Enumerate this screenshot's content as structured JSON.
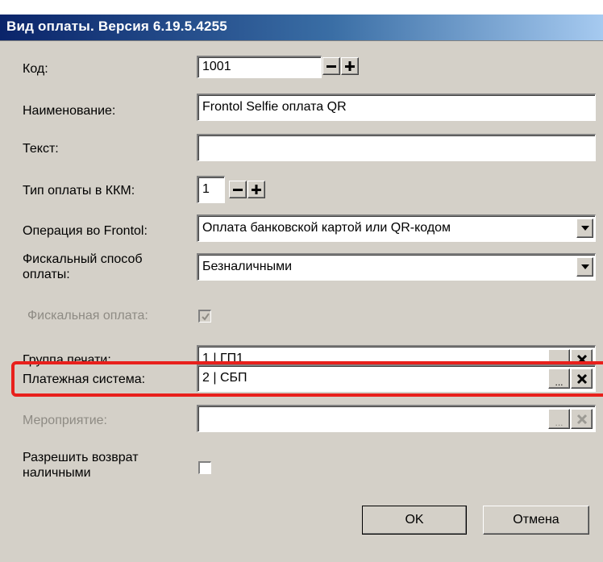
{
  "window": {
    "title": "Вид оплаты. Версия 6.19.5.4255"
  },
  "fields": {
    "code": {
      "label": "Код:",
      "value": "1001"
    },
    "name": {
      "label": "Наименование:",
      "value": "Frontol Selfie оплата QR"
    },
    "text": {
      "label": "Текст:",
      "value": ""
    },
    "kkm_type": {
      "label": "Тип оплаты в ККМ:",
      "value": "1"
    },
    "frontol_operation": {
      "label": "Операция во Frontol:",
      "value": "Оплата банковской картой или QR-кодом"
    },
    "fiscal_method": {
      "label_line1": "Фискальный способ",
      "label_line2": "оплаты:",
      "value": "Безналичными"
    },
    "fiscal_payment": {
      "label": "Фискальная оплата:",
      "checked": true,
      "enabled": false
    },
    "print_group": {
      "label": "Группа печати:",
      "value": "1 | ГП1"
    },
    "payment_system": {
      "label": "Платежная система:",
      "value": "2 | СБП"
    },
    "event": {
      "label": "Мероприятие:",
      "value": "",
      "enabled": false
    },
    "allow_cash_return": {
      "label_line1": "Разрешить возврат",
      "label_line2": "наличными",
      "checked": false
    }
  },
  "buttons": {
    "ok": "OK",
    "cancel": "Отмена",
    "browse": "..."
  },
  "colors": {
    "highlight": "#e8201c",
    "title_start": "#0a246a",
    "dialog_bg": "#d4d0c8"
  },
  "icons": [
    "minus-icon",
    "plus-icon",
    "dropdown-arrow-icon",
    "ellipsis-icon",
    "close-x-icon",
    "checkmark-icon"
  ]
}
